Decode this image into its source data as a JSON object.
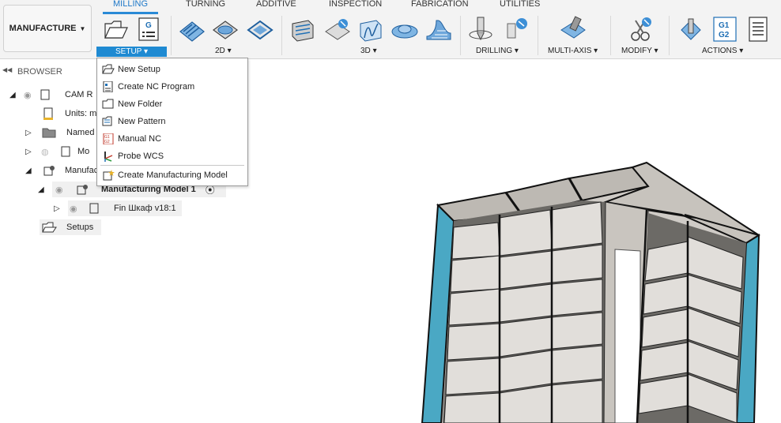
{
  "workspace": {
    "label": "MANUFACTURE"
  },
  "tabs": [
    "MILLING",
    "TURNING",
    "ADDITIVE",
    "INSPECTION",
    "FABRICATION",
    "UTILITIES"
  ],
  "groups": {
    "setup": "SETUP",
    "g2d": "2D",
    "g3d": "3D",
    "drilling": "DRILLING",
    "multiaxis": "MULTI-AXIS",
    "modify": "MODIFY",
    "actions": "ACTIONS"
  },
  "actions_icon_text": {
    "top": "G1",
    "bottom": "G2"
  },
  "nc_icon_text": "G",
  "browser": {
    "title": "BROWSER",
    "items": [
      {
        "label": "CAM R"
      },
      {
        "label": "Units: m"
      },
      {
        "label": "Named V"
      },
      {
        "label": "Mo"
      },
      {
        "label": "Manufac"
      },
      {
        "label": "Manufacturing Model 1"
      },
      {
        "label": "Fin Шкаф v18:1"
      },
      {
        "label": "Setups"
      }
    ]
  },
  "setup_menu": {
    "items": [
      {
        "label": "New Setup",
        "icon": "new-setup-icon"
      },
      {
        "label": "Create NC Program",
        "icon": "nc-program-icon"
      },
      {
        "label": "New Folder",
        "icon": "folder-icon"
      },
      {
        "label": "New Pattern",
        "icon": "pattern-icon"
      },
      {
        "label": "Manual NC",
        "icon": "manual-nc-icon"
      },
      {
        "label": "Probe WCS",
        "icon": "probe-wcs-icon"
      },
      {
        "label": "Create Manufacturing Model",
        "icon": "manufacturing-model-icon"
      }
    ]
  },
  "colors": {
    "accent": "#1f8ad2",
    "cabinet_side": "#4aa8c4",
    "cabinet_shelf": "#d9d6d2"
  }
}
